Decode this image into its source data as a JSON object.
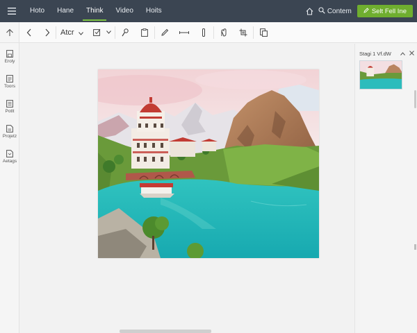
{
  "topbar": {
    "menu_icon": "hamburger-icon",
    "nav": [
      "Hoto",
      "Hane",
      "Think",
      "Video",
      "Hoits"
    ],
    "active_index": 2,
    "content_label": "Contem",
    "cta_label": "Selt Fell Ine",
    "accent_color": "#7cc242",
    "bg_color": "#3b4552"
  },
  "toolbar": {
    "font_name": "Atcr",
    "icons": [
      "chevron-left-icon",
      "chevron-right-icon",
      "dropdown-icon",
      "checkbox-icon",
      "dropdown-icon",
      "brush-icon",
      "clipboard-icon",
      "pen-icon",
      "ruler-icon",
      "line-icon",
      "hand-icon",
      "crop-icon",
      "copy-icon"
    ]
  },
  "rail": {
    "items": [
      {
        "label": "Eroly",
        "icon": "save-icon"
      },
      {
        "label": "Toors",
        "icon": "document-icon"
      },
      {
        "label": "Potlt",
        "icon": "list-icon"
      },
      {
        "label": "Projetz",
        "icon": "file-icon"
      },
      {
        "label": "Aetags",
        "icon": "tag-icon"
      }
    ]
  },
  "panel": {
    "title": "Stagi 1 Vf.dW"
  }
}
